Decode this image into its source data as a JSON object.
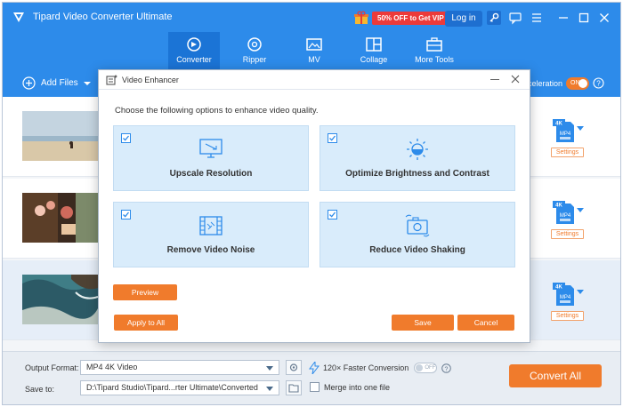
{
  "app": {
    "title": "Tipard Video Converter Ultimate",
    "promo_text": "50% OFF to Get VIP",
    "login_label": "Log in"
  },
  "nav": {
    "items": [
      {
        "label": "Converter",
        "icon": "converter-icon",
        "active": true
      },
      {
        "label": "Ripper",
        "icon": "disc-icon",
        "active": false
      },
      {
        "label": "MV",
        "icon": "image-icon",
        "active": false
      },
      {
        "label": "Collage",
        "icon": "collage-icon",
        "active": false
      },
      {
        "label": "More Tools",
        "icon": "toolbox-icon",
        "active": false
      }
    ]
  },
  "toolbar": {
    "add_files_label": "Add Files",
    "acceleration_label": "celeration",
    "acceleration_toggle": "ON"
  },
  "files": [
    {
      "format_badge": "4K",
      "format_label": "MP4",
      "settings_label": "Settings"
    },
    {
      "format_badge": "4K",
      "format_label": "MP4",
      "settings_label": "Settings"
    },
    {
      "format_badge": "4K",
      "format_label": "MP4",
      "settings_label": "Settings"
    }
  ],
  "bottom": {
    "output_format_label": "Output Format:",
    "output_format_value": "MP4 4K Video",
    "save_to_label": "Save to:",
    "save_to_value": "D:\\Tipard Studio\\Tipard...rter Ultimate\\Converted",
    "faster_label": "120× Faster Conversion",
    "faster_toggle": "OFF",
    "merge_label": "Merge into one file",
    "convert_all_label": "Convert All"
  },
  "dialog": {
    "title": "Video Enhancer",
    "description": "Choose the following options to enhance video quality.",
    "options": [
      {
        "label": "Upscale Resolution",
        "checked": true,
        "icon": "monitor-upscale-icon"
      },
      {
        "label": "Optimize Brightness and Contrast",
        "checked": true,
        "icon": "sun-brightness-icon"
      },
      {
        "label": "Remove Video Noise",
        "checked": true,
        "icon": "film-noise-icon"
      },
      {
        "label": "Reduce Video Shaking",
        "checked": true,
        "icon": "camera-stabilize-icon"
      }
    ],
    "preview_label": "Preview",
    "apply_all_label": "Apply to All",
    "save_label": "Save",
    "cancel_label": "Cancel"
  },
  "colors": {
    "primary": "#2d8bea",
    "accent": "#f07b2c",
    "option_bg": "#d9ecfb"
  }
}
